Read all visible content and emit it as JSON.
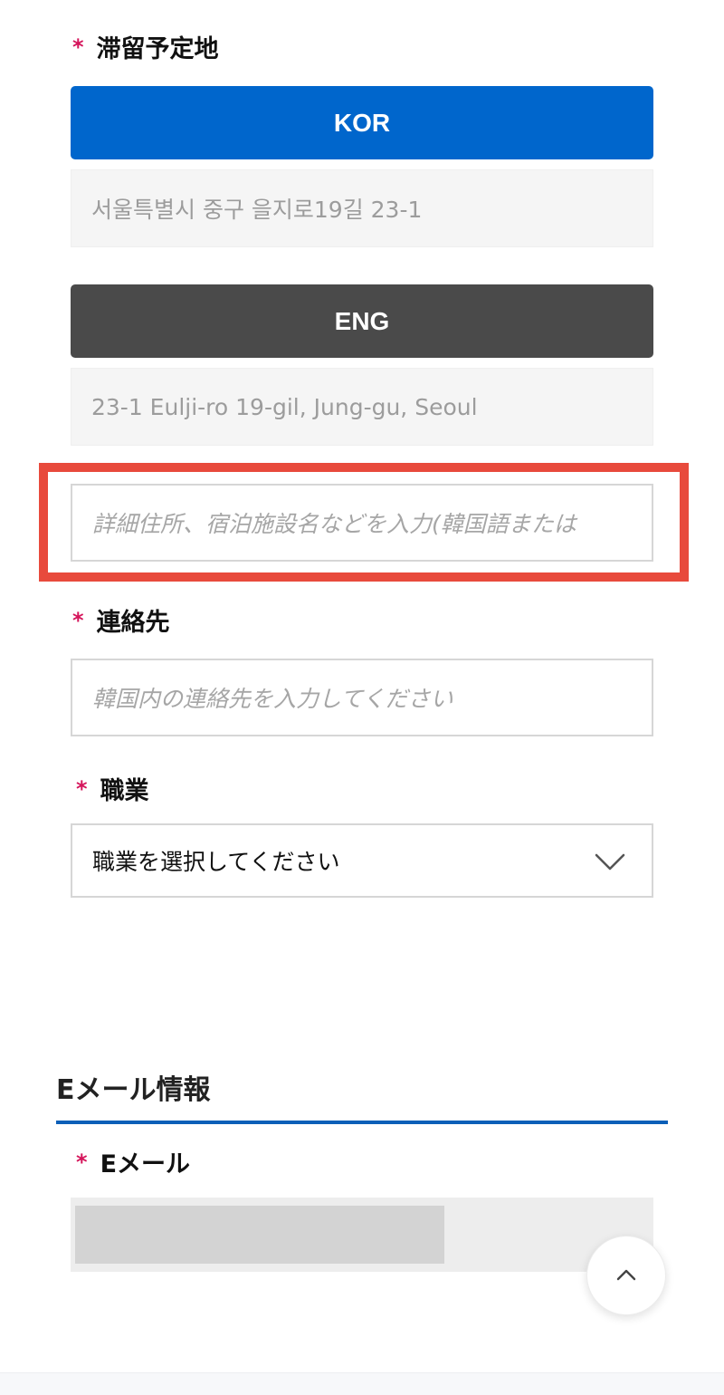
{
  "stay_address": {
    "label": "滞留予定地",
    "kor_button": "KOR",
    "kor_address": "서울특별시 중구 을지로19길 23-1",
    "eng_button": "ENG",
    "eng_address": "23-1 Eulji-ro 19-gil, Jung-gu, Seoul",
    "detail_placeholder": "詳細住所、宿泊施設名などを入力(韓国語または"
  },
  "contact": {
    "label": "連絡先",
    "placeholder": "韓国内の連絡先を入力してください"
  },
  "occupation": {
    "label": "職業",
    "selected": "職業を選択してください"
  },
  "email_section": {
    "title": "Eメール情報",
    "email_label": "Eメール"
  },
  "required_marker": "*",
  "icons": {
    "select_arrow": "chevron-down-icon",
    "scroll_top": "chevron-up-icon"
  },
  "colors": {
    "kor_button": "#0066cc",
    "eng_button": "#4a4a4a",
    "required": "#d5155b",
    "highlight": "#e84a3c",
    "section_line": "#0b5fb8"
  }
}
